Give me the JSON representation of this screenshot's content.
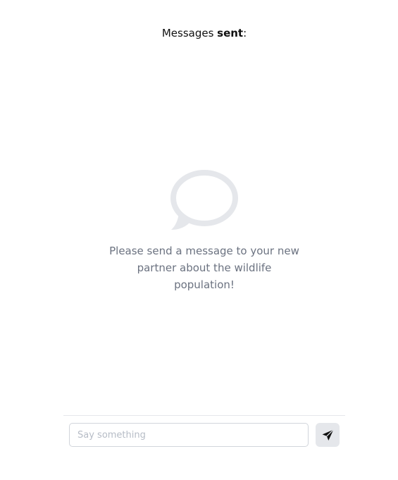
{
  "header": {
    "prefix": "Messages ",
    "emphasis": "sent",
    "suffix": ":"
  },
  "empty_state": {
    "icon": "chat-bubble-icon",
    "message": "Please send a message to your new partner about the wildlife population!"
  },
  "composer": {
    "placeholder": "Say something",
    "value": "",
    "send_icon": "paper-plane-icon"
  },
  "colors": {
    "muted_text": "#6b7280",
    "icon_gray": "#e5e7eb",
    "send_button_bg": "#e5e7eb"
  }
}
